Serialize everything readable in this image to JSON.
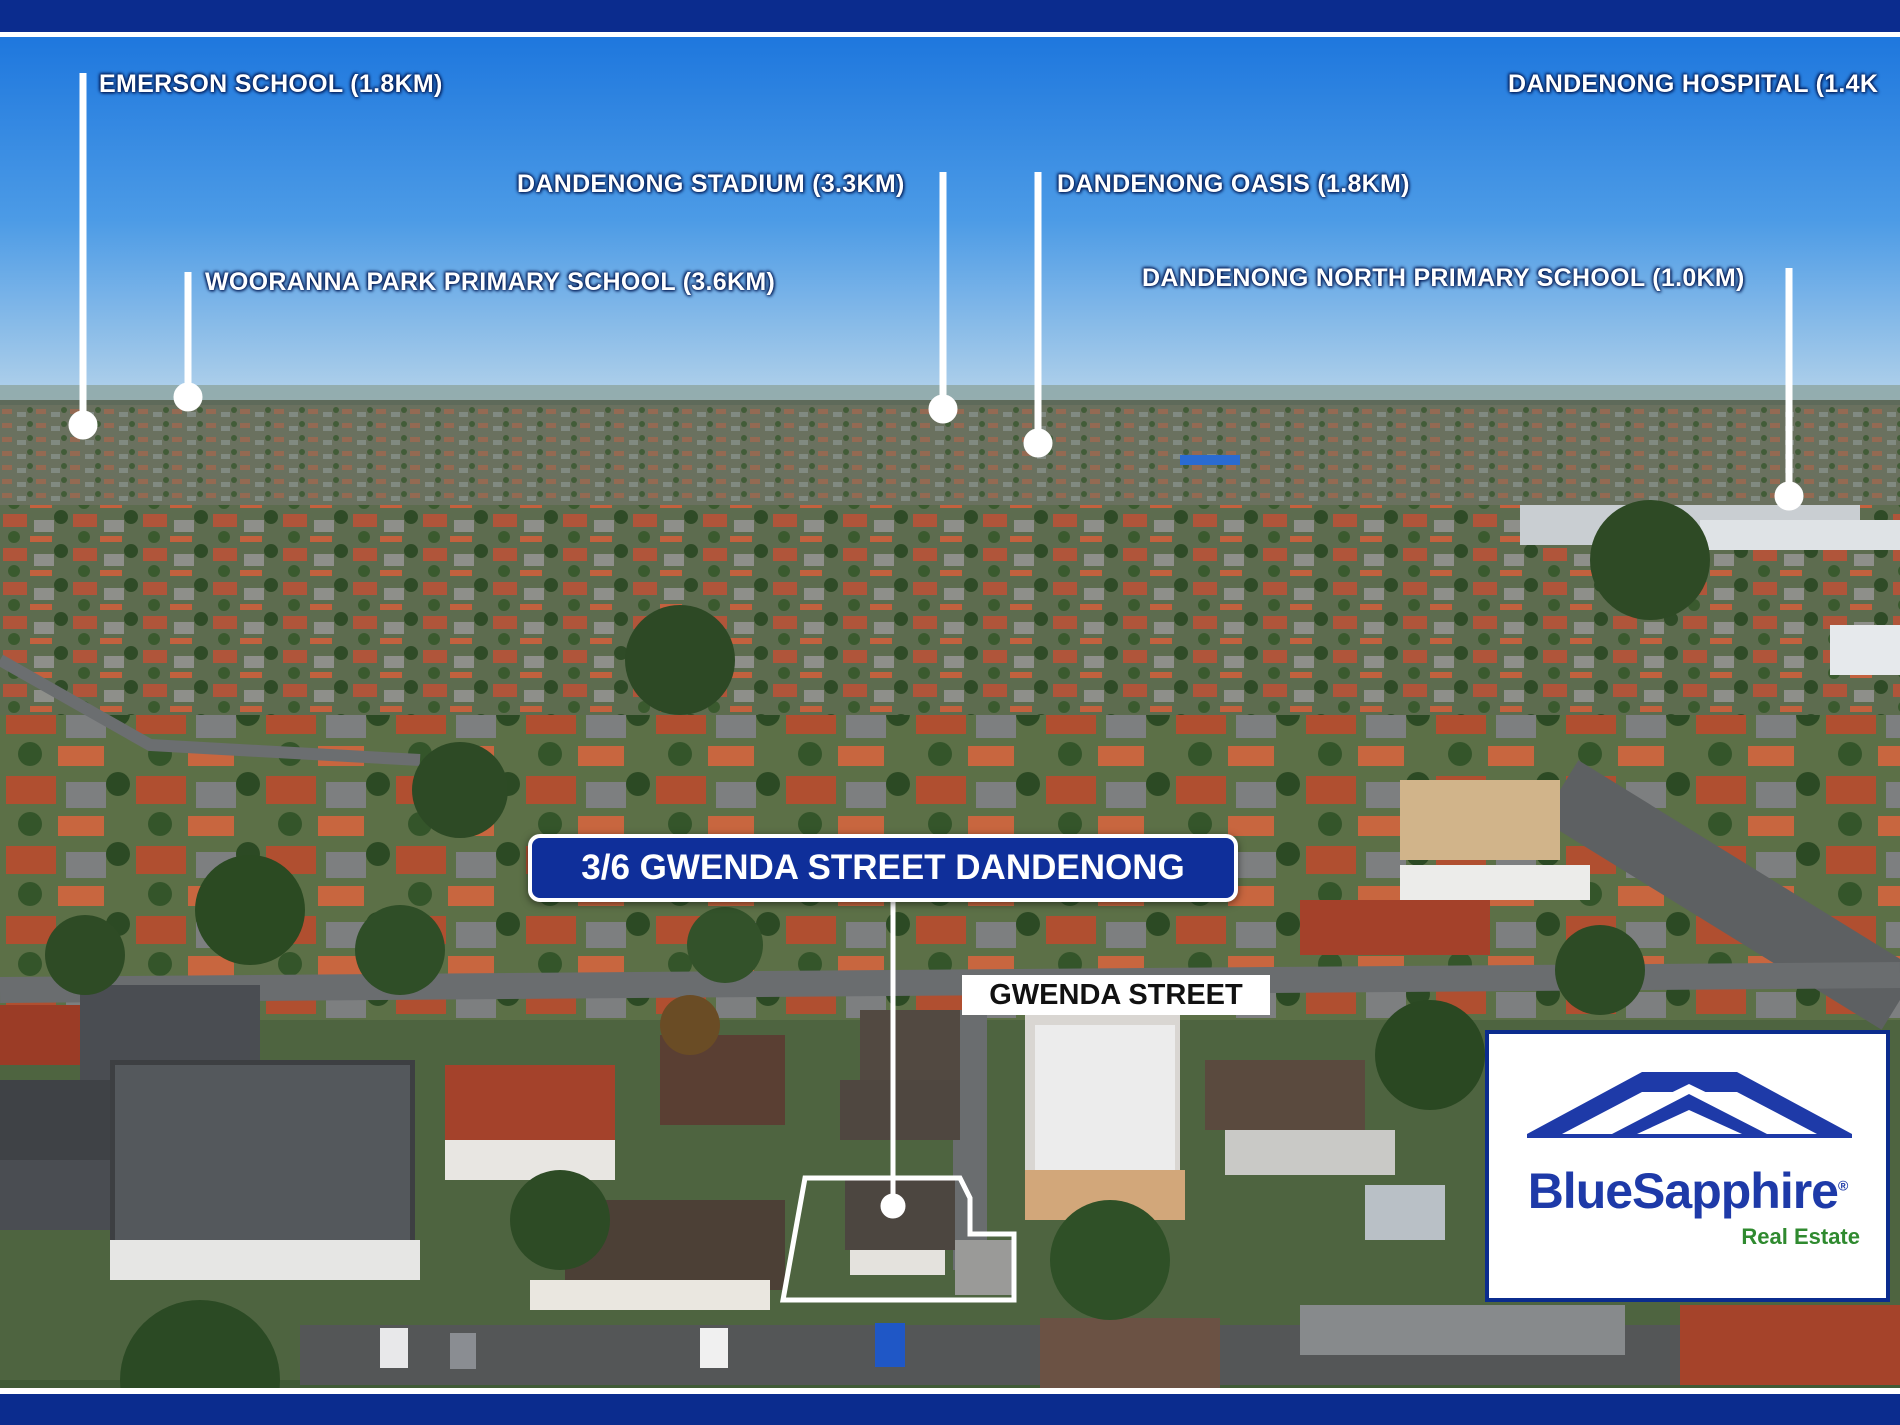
{
  "property": {
    "address": "3/6 GWENDA STREET DANDENONG",
    "street_name": "GWENDA STREET"
  },
  "points_of_interest": [
    {
      "label": "EMERSON SCHOOL (1.8KM)"
    },
    {
      "label": "WOORANNA PARK PRIMARY SCHOOL (3.6KM)"
    },
    {
      "label": "DANDENONG STADIUM (3.3KM)"
    },
    {
      "label": "DANDENONG OASIS (1.8KM)"
    },
    {
      "label": "DANDENONG HOSPITAL (1.4K"
    },
    {
      "label": "DANDENONG NORTH PRIMARY SCHOOL (1.0KM)"
    }
  ],
  "logo": {
    "brand_name": "BlueSapphire",
    "registered_mark": "®",
    "tagline": "Real Estate"
  },
  "colors": {
    "frame_blue": "#0b2c8e",
    "sky_top": "#1a78e0",
    "sky_horizon": "#a9cbe8",
    "label_box_blue": "#0f2f9a",
    "logo_blue": "#1e3aa8",
    "logo_green": "#2f8a2f",
    "roof_terracotta": "#b5532e"
  }
}
